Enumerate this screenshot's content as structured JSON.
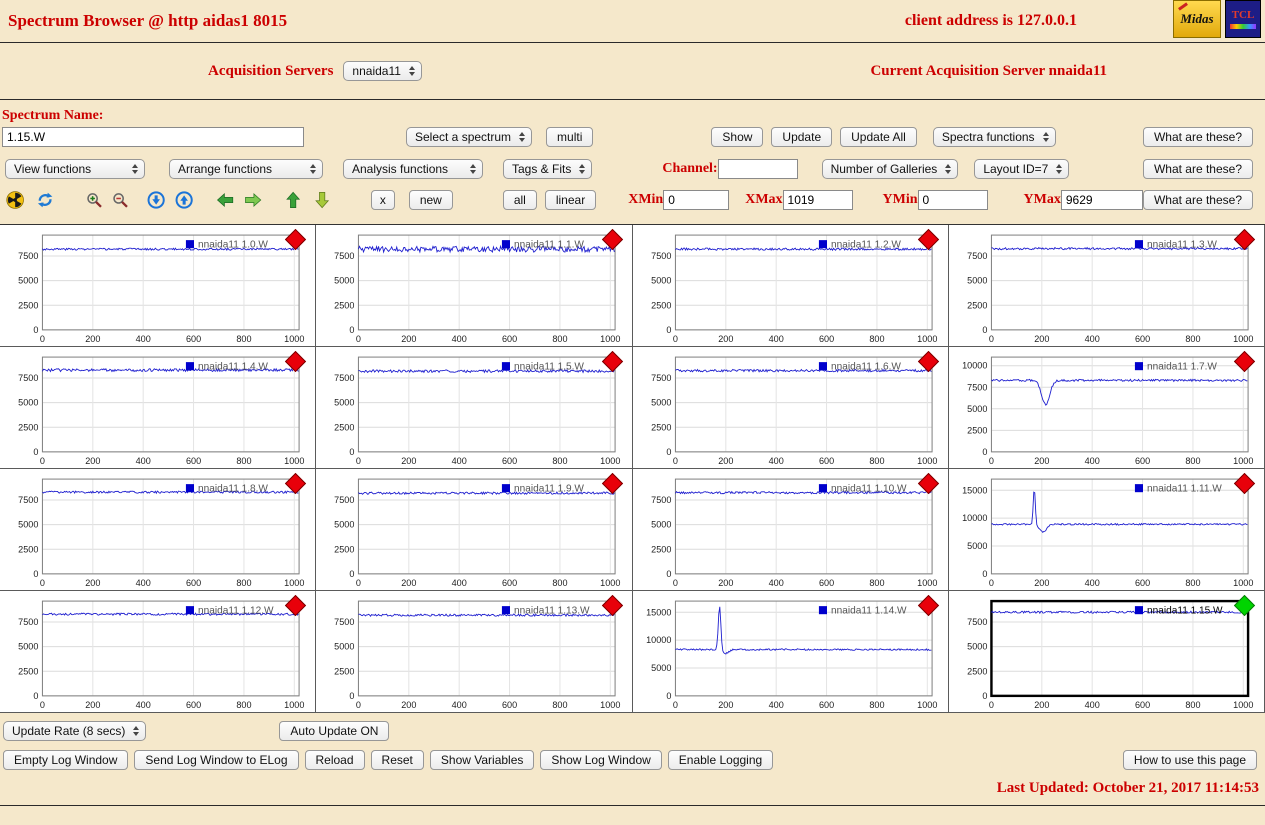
{
  "header": {
    "title": "Spectrum Browser @ http aidas1 8015",
    "client": "client address is 127.0.0.1",
    "logo1": "Midas",
    "logo2": "TCL"
  },
  "acquisition": {
    "label": "Acquisition Servers",
    "server_select": "nnaida11",
    "current": "Current Acquisition Server nnaida11"
  },
  "common": {
    "what_are_these": "What are these?"
  },
  "spectrum": {
    "label": "Spectrum Name:",
    "name_value": "1.15.W",
    "select_placeholder": "Select a spectrum",
    "multi": "multi",
    "show": "Show",
    "update": "Update",
    "update_all": "Update All",
    "spectra_functions": "Spectra functions"
  },
  "functions_row": {
    "view": "View functions",
    "arrange": "Arrange functions",
    "analysis": "Analysis functions",
    "tags": "Tags & Fits",
    "channel_label": "Channel:",
    "channel_value": "",
    "galleries": "Number of Galleries",
    "layout": "Layout ID=7"
  },
  "toolbar": {
    "x": "x",
    "new": "new",
    "all": "all",
    "linear": "linear",
    "xmin_label": "XMin",
    "xmin": "0",
    "xmax_label": "XMax",
    "xmax": "1019",
    "ymin_label": "YMin",
    "ymin": "0",
    "ymax_label": "YMax",
    "ymax": "9629",
    "icons": [
      "radiation-icon",
      "refresh-icon",
      "zoom-in-icon",
      "zoom-out-icon",
      "arrow-down-circle-icon",
      "arrow-up-circle-icon",
      "arrow-left-icon",
      "arrow-right-icon",
      "arrow-up-icon",
      "arrow-down-icon"
    ]
  },
  "footer": {
    "update_rate": "Update Rate (8 secs)",
    "auto_update": "Auto Update ON",
    "buttons": [
      "Empty Log Window",
      "Send Log Window to ELog",
      "Reload",
      "Reset",
      "Show Variables",
      "Show Log Window",
      "Enable Logging"
    ],
    "help": "How to use this page",
    "last_updated": "Last Updated: October 21, 2017 11:14:53"
  },
  "colors": {
    "accent_red": "#cc0000",
    "trace_blue": "#2020cf",
    "diamond_red": "#e8000a",
    "diamond_green": "#00d400",
    "background": "#f5e8cb"
  },
  "chart_data": [
    {
      "type": "line",
      "name": "nnaida11 1.0.W",
      "x_max": 1019,
      "x_ticks": [
        0,
        200,
        400,
        600,
        800,
        1000
      ],
      "y_ticks": [
        0,
        2500,
        5000,
        7500
      ],
      "y_max": 9629,
      "baseline": 8200,
      "noise": 100,
      "features": [],
      "marker": "red",
      "selected": false
    },
    {
      "type": "line",
      "name": "nnaida11 1.1.W",
      "x_max": 1019,
      "x_ticks": [
        0,
        200,
        400,
        600,
        800,
        1000
      ],
      "y_ticks": [
        0,
        2500,
        5000,
        7500
      ],
      "y_max": 9629,
      "baseline": 8200,
      "noise": 300,
      "features": [],
      "marker": "red",
      "selected": false
    },
    {
      "type": "line",
      "name": "nnaida11 1.2.W",
      "x_max": 1019,
      "x_ticks": [
        0,
        200,
        400,
        600,
        800,
        1000
      ],
      "y_ticks": [
        0,
        2500,
        5000,
        7500
      ],
      "y_max": 9629,
      "baseline": 8200,
      "noise": 110,
      "features": [],
      "marker": "red",
      "selected": false
    },
    {
      "type": "line",
      "name": "nnaida11 1.3.W",
      "x_max": 1019,
      "x_ticks": [
        0,
        200,
        400,
        600,
        800,
        1000
      ],
      "y_ticks": [
        0,
        2500,
        5000,
        7500
      ],
      "y_max": 9629,
      "baseline": 8250,
      "noise": 110,
      "features": [],
      "marker": "red",
      "selected": false
    },
    {
      "type": "line",
      "name": "nnaida11 1.4.W",
      "x_max": 1019,
      "x_ticks": [
        0,
        200,
        400,
        600,
        800,
        1000
      ],
      "y_ticks": [
        0,
        2500,
        5000,
        7500
      ],
      "y_max": 9629,
      "baseline": 8300,
      "noise": 140,
      "features": [],
      "marker": "red",
      "selected": false
    },
    {
      "type": "line",
      "name": "nnaida11 1.5.W",
      "x_max": 1019,
      "x_ticks": [
        0,
        200,
        400,
        600,
        800,
        1000
      ],
      "y_ticks": [
        0,
        2500,
        5000,
        7500
      ],
      "y_max": 9629,
      "baseline": 8200,
      "noise": 130,
      "features": [],
      "marker": "red",
      "selected": false
    },
    {
      "type": "line",
      "name": "nnaida11 1.6.W",
      "x_max": 1019,
      "x_ticks": [
        0,
        200,
        400,
        600,
        800,
        1000
      ],
      "y_ticks": [
        0,
        2500,
        5000,
        7500
      ],
      "y_max": 9629,
      "baseline": 8250,
      "noise": 120,
      "features": [],
      "marker": "red",
      "selected": false
    },
    {
      "type": "line",
      "name": "nnaida11 1.7.W",
      "x_max": 1019,
      "x_ticks": [
        0,
        200,
        400,
        600,
        800,
        1000
      ],
      "y_ticks": [
        0,
        2500,
        5000,
        7500,
        10000
      ],
      "y_max": 11000,
      "baseline": 8300,
      "noise": 120,
      "features": [
        {
          "x": 215,
          "width": 16,
          "amp": -2800
        }
      ],
      "marker": "red",
      "selected": false
    },
    {
      "type": "line",
      "name": "nnaida11 1.8.W",
      "x_max": 1019,
      "x_ticks": [
        0,
        200,
        400,
        600,
        800,
        1000
      ],
      "y_ticks": [
        0,
        2500,
        5000,
        7500
      ],
      "y_max": 9629,
      "baseline": 8300,
      "noise": 110,
      "features": [],
      "marker": "red",
      "selected": false
    },
    {
      "type": "line",
      "name": "nnaida11 1.9.W",
      "x_max": 1019,
      "x_ticks": [
        0,
        200,
        400,
        600,
        800,
        1000
      ],
      "y_ticks": [
        0,
        2500,
        5000,
        7500
      ],
      "y_max": 9629,
      "baseline": 8200,
      "noise": 110,
      "features": [],
      "marker": "red",
      "selected": false
    },
    {
      "type": "line",
      "name": "nnaida11 1.10.W",
      "x_max": 1019,
      "x_ticks": [
        0,
        200,
        400,
        600,
        800,
        1000
      ],
      "y_ticks": [
        0,
        2500,
        5000,
        7500
      ],
      "y_max": 9629,
      "baseline": 8250,
      "noise": 110,
      "features": [],
      "marker": "red",
      "selected": false
    },
    {
      "type": "line",
      "name": "nnaida11 1.11.W",
      "x_max": 1019,
      "x_ticks": [
        0,
        200,
        400,
        600,
        800,
        1000
      ],
      "y_ticks": [
        0,
        5000,
        10000,
        15000
      ],
      "y_max": 17000,
      "baseline": 8900,
      "noise": 150,
      "features": [
        {
          "x": 170,
          "width": 4,
          "amp": 6600
        },
        {
          "x": 205,
          "width": 14,
          "amp": -1400
        }
      ],
      "marker": "red",
      "selected": false
    },
    {
      "type": "line",
      "name": "nnaida11 1.12.W",
      "x_max": 1019,
      "x_ticks": [
        0,
        200,
        400,
        600,
        800,
        1000
      ],
      "y_ticks": [
        0,
        2500,
        5000,
        7500
      ],
      "y_max": 9629,
      "baseline": 8300,
      "noise": 110,
      "features": [],
      "marker": "red",
      "selected": false
    },
    {
      "type": "line",
      "name": "nnaida11 1.13.W",
      "x_max": 1019,
      "x_ticks": [
        0,
        200,
        400,
        600,
        800,
        1000
      ],
      "y_ticks": [
        0,
        2500,
        5000,
        7500
      ],
      "y_max": 9629,
      "baseline": 8200,
      "noise": 110,
      "features": [],
      "marker": "red",
      "selected": false
    },
    {
      "type": "line",
      "name": "nnaida11 1.14.W",
      "x_max": 1019,
      "x_ticks": [
        0,
        200,
        400,
        600,
        800,
        1000
      ],
      "y_ticks": [
        0,
        5000,
        10000,
        15000
      ],
      "y_max": 17000,
      "baseline": 8300,
      "noise": 140,
      "features": [
        {
          "x": 175,
          "width": 5,
          "amp": 7900
        },
        {
          "x": 200,
          "width": 12,
          "amp": -700
        }
      ],
      "marker": "red",
      "selected": false
    },
    {
      "type": "line",
      "name": "nnaida11 1.15.W",
      "x_max": 1019,
      "x_ticks": [
        0,
        200,
        400,
        600,
        800,
        1000
      ],
      "y_ticks": [
        0,
        2500,
        5000,
        7500
      ],
      "y_max": 9629,
      "baseline": 8500,
      "noise": 100,
      "features": [],
      "marker": "green",
      "selected": true
    }
  ]
}
